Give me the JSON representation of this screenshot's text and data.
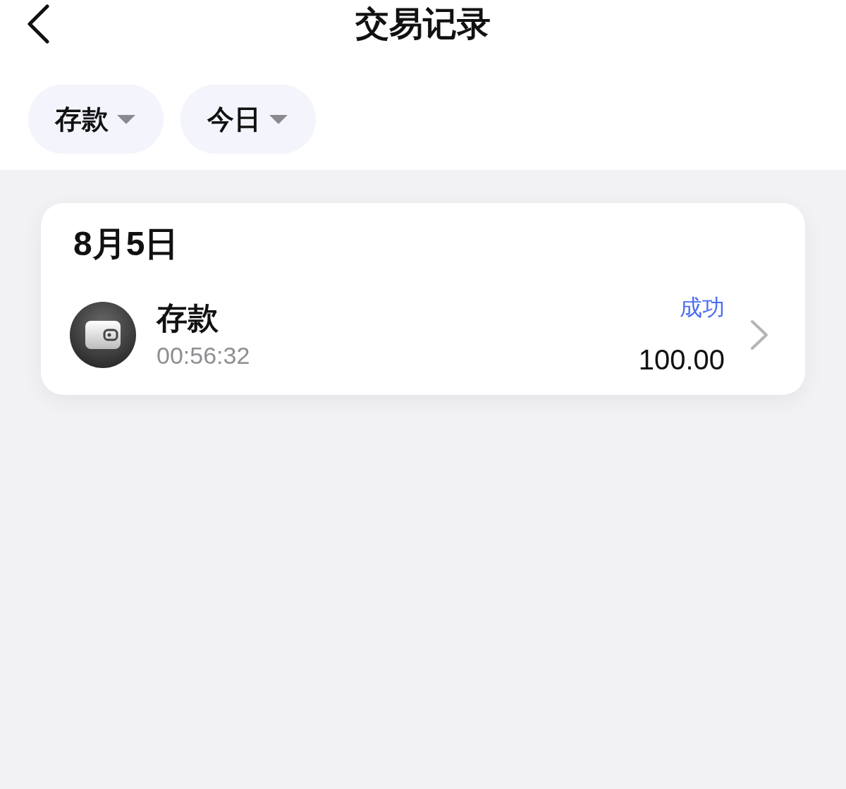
{
  "header": {
    "title": "交易记录"
  },
  "filters": [
    {
      "label": "存款"
    },
    {
      "label": "今日"
    }
  ],
  "groups": [
    {
      "date": "8月5日",
      "transactions": [
        {
          "title": "存款",
          "time": "00:56:32",
          "status": {
            "text": "成功",
            "kind": "success"
          },
          "amount": "100.00"
        }
      ]
    }
  ]
}
